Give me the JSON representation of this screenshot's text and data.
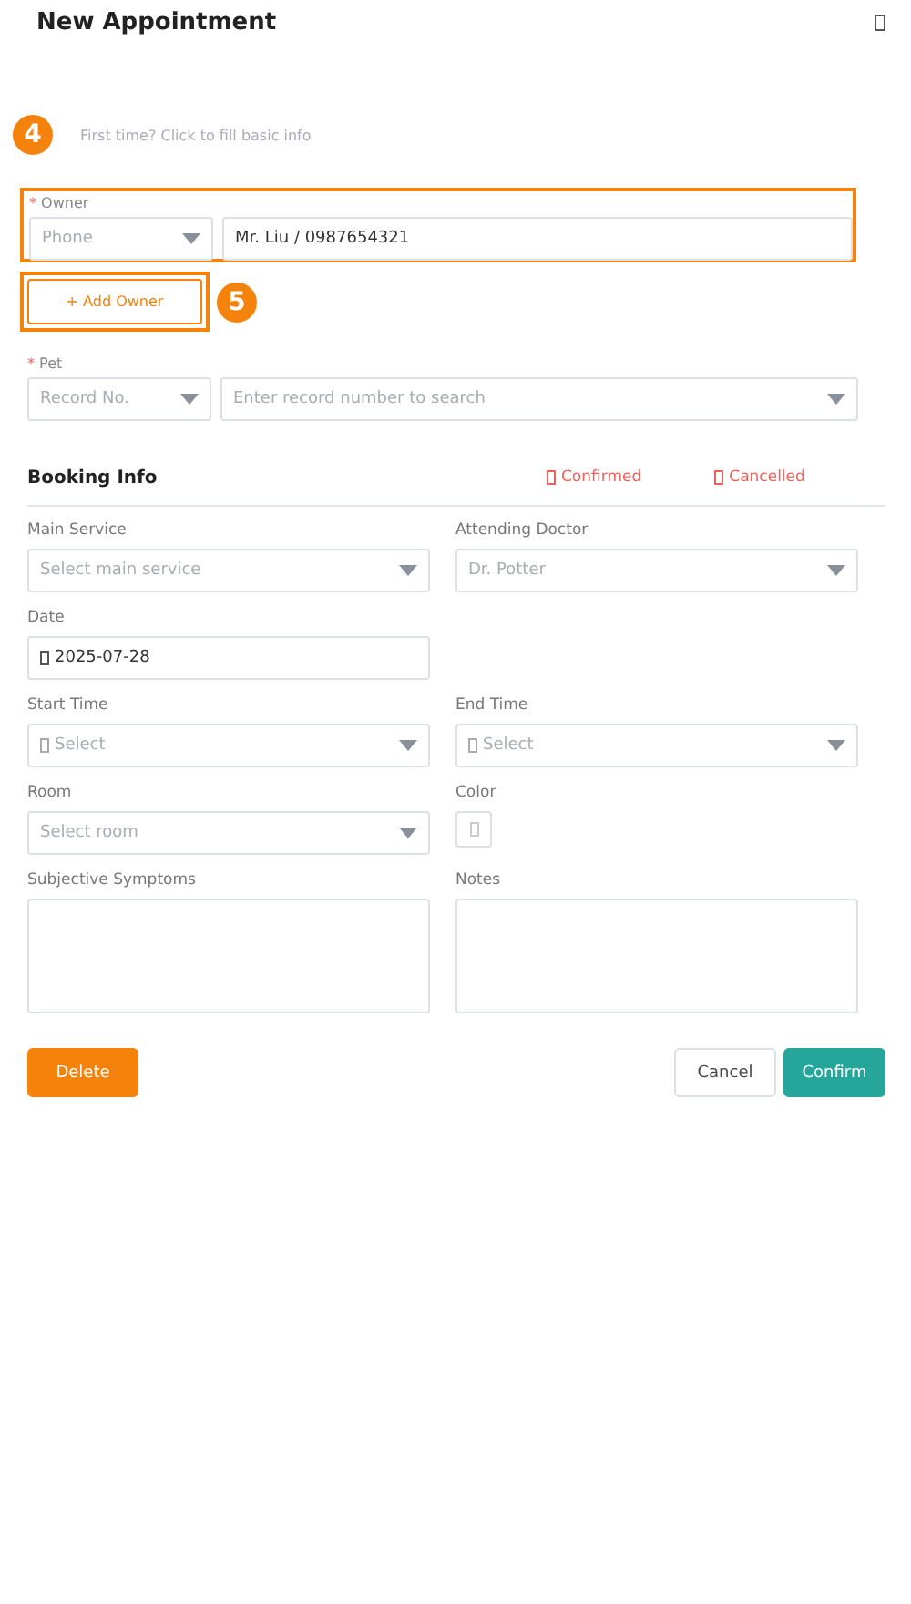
{
  "dialog": {
    "title": "New Appointment"
  },
  "hint": {
    "marker": "4",
    "text": "First time? Click to fill basic info"
  },
  "owner": {
    "label": "Owner",
    "required_mark": "*",
    "highlighted": true,
    "type_select": {
      "placeholder": "Phone"
    },
    "search": {
      "value": "Mr. Liu / 0987654321"
    }
  },
  "add_owner": {
    "label": "+ Add Owner",
    "marker": "5",
    "highlighted": true
  },
  "pet": {
    "label": "Pet",
    "required_mark": "*",
    "type_select": {
      "placeholder": "Record No."
    },
    "search": {
      "placeholder": "Enter record number to search"
    }
  },
  "booking": {
    "title": "Booking Info",
    "legend": [
      {
        "label": "Confirmed",
        "color": "#f0605a"
      },
      {
        "label": "Cancelled",
        "color": "#f0605a"
      }
    ]
  },
  "rows": [
    [
      {
        "kind": "select",
        "label": "Main Service",
        "placeholder": "Select main service"
      },
      {
        "kind": "select",
        "label": "Attending Doctor",
        "placeholder": "Dr. Potter"
      }
    ],
    [
      {
        "kind": "date",
        "label": "Date",
        "value": "2025-07-28"
      }
    ],
    [
      {
        "kind": "select",
        "label": "Start Time",
        "placeholder": "Select",
        "icon": true
      },
      {
        "kind": "select",
        "label": "End Time",
        "placeholder": "Select",
        "icon": true
      }
    ],
    [
      {
        "kind": "select",
        "label": "Room",
        "placeholder": "Select room"
      },
      {
        "kind": "color",
        "label": "Color"
      }
    ],
    [
      {
        "kind": "textarea",
        "label": "Subjective Symptoms"
      },
      {
        "kind": "textarea",
        "label": "Notes"
      }
    ]
  ],
  "buttons": [
    {
      "label": "Delete",
      "kind": "danger"
    },
    {
      "label": "Cancel",
      "kind": "plain"
    },
    {
      "label": "Confirm",
      "kind": "primary"
    }
  ]
}
